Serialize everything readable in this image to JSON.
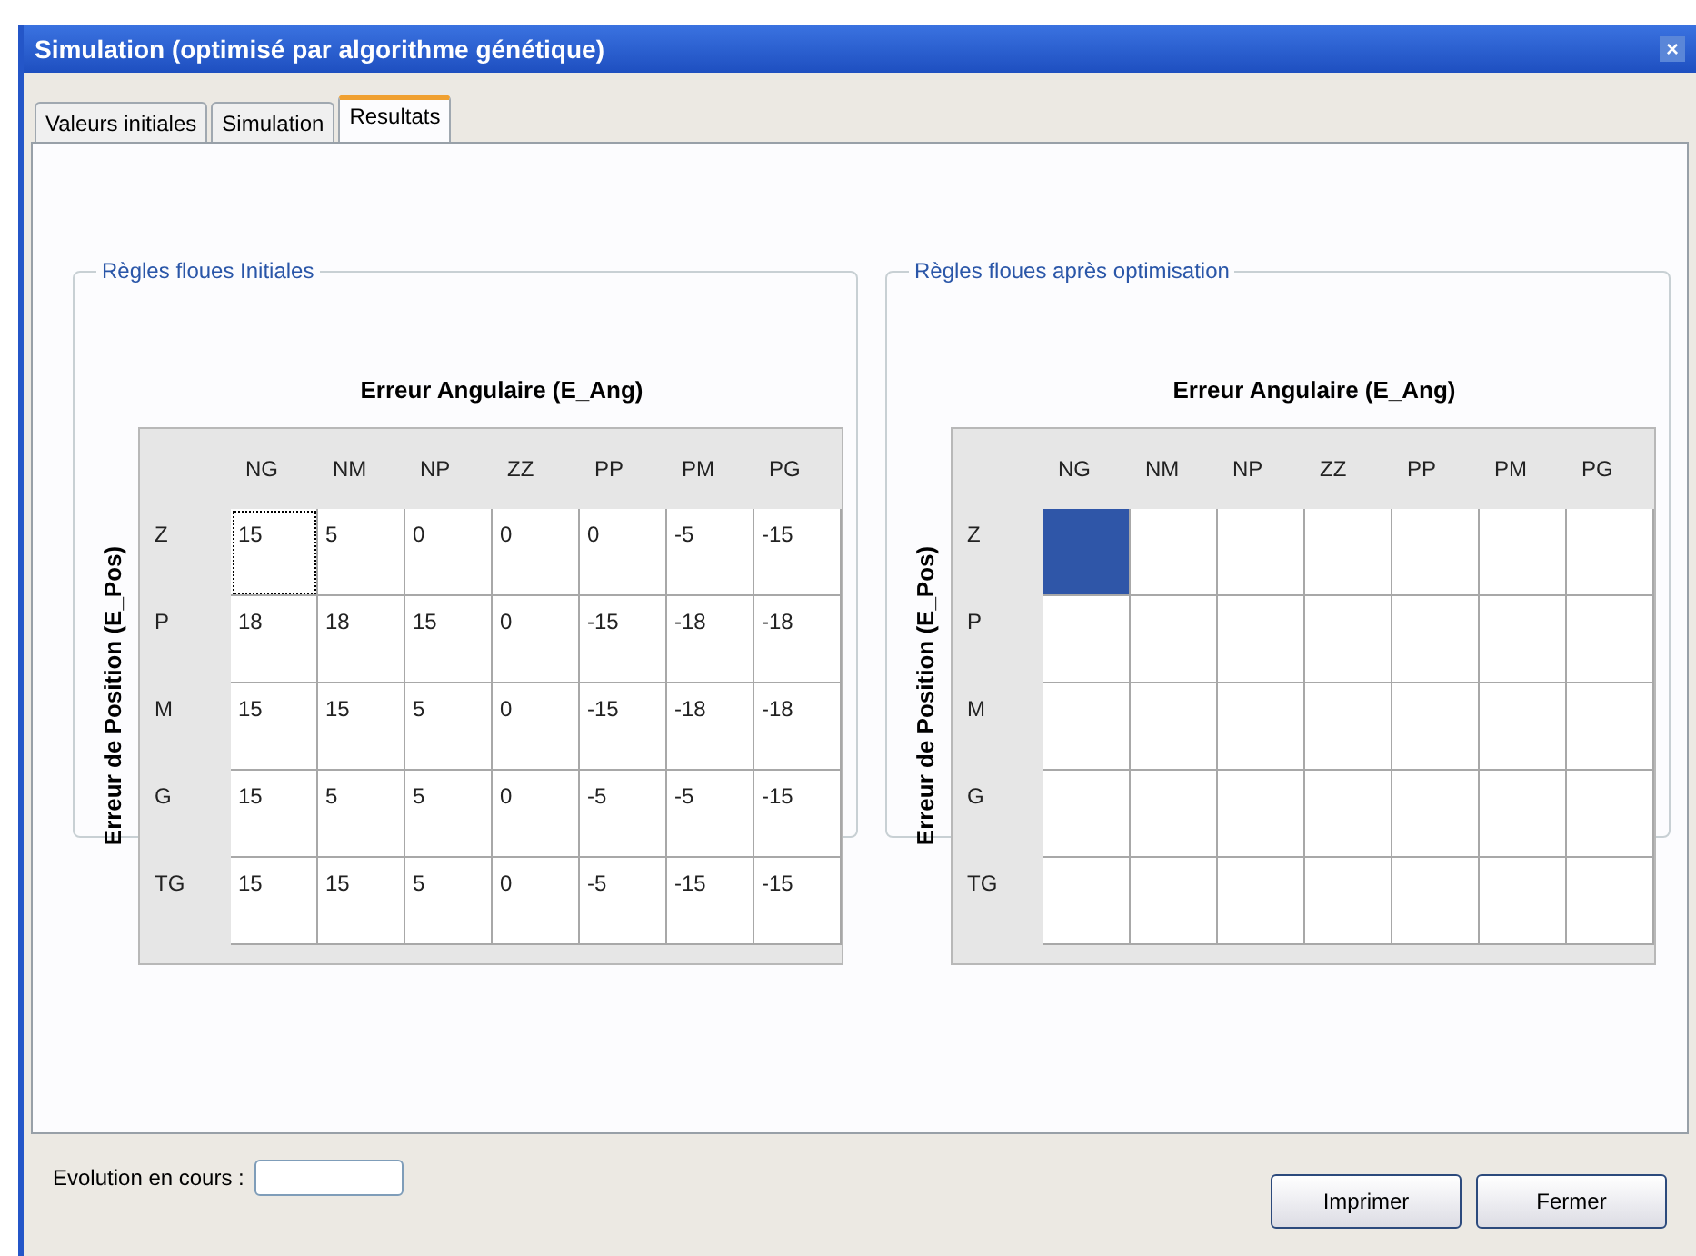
{
  "window": {
    "title": "Simulation (optimisé par algorithme génétique)",
    "close": "×"
  },
  "tabs": [
    {
      "label": "Valeurs initiales",
      "selected": false
    },
    {
      "label": "Simulation",
      "selected": false
    },
    {
      "label": "Resultats",
      "selected": true
    }
  ],
  "groups": [
    {
      "title": "Règles floues Initiales",
      "table_title": "Erreur Angulaire (E_Ang)",
      "row_axis": "Erreur de Position (E_Pos)",
      "columns": [
        "NG",
        "NM",
        "NP",
        "ZZ",
        "PP",
        "PM",
        "PG"
      ],
      "rows": [
        {
          "label": "Z",
          "cells": [
            {
              "value": "15",
              "selected": false,
              "focused": true
            },
            {
              "value": "5",
              "selected": false,
              "focused": false
            },
            {
              "value": "0",
              "selected": false,
              "focused": false
            },
            {
              "value": "0",
              "selected": false,
              "focused": false
            },
            {
              "value": "0",
              "selected": false,
              "focused": false
            },
            {
              "value": "-5",
              "selected": false,
              "focused": false
            },
            {
              "value": "-15",
              "selected": false,
              "focused": false
            }
          ]
        },
        {
          "label": "P",
          "cells": [
            {
              "value": "18",
              "selected": false,
              "focused": false
            },
            {
              "value": "18",
              "selected": false,
              "focused": false
            },
            {
              "value": "15",
              "selected": false,
              "focused": false
            },
            {
              "value": "0",
              "selected": false,
              "focused": false
            },
            {
              "value": "-15",
              "selected": false,
              "focused": false
            },
            {
              "value": "-18",
              "selected": false,
              "focused": false
            },
            {
              "value": "-18",
              "selected": false,
              "focused": false
            }
          ]
        },
        {
          "label": "M",
          "cells": [
            {
              "value": "15",
              "selected": false,
              "focused": false
            },
            {
              "value": "15",
              "selected": false,
              "focused": false
            },
            {
              "value": "5",
              "selected": false,
              "focused": false
            },
            {
              "value": "0",
              "selected": false,
              "focused": false
            },
            {
              "value": "-15",
              "selected": false,
              "focused": false
            },
            {
              "value": "-18",
              "selected": false,
              "focused": false
            },
            {
              "value": "-18",
              "selected": false,
              "focused": false
            }
          ]
        },
        {
          "label": "G",
          "cells": [
            {
              "value": "15",
              "selected": false,
              "focused": false
            },
            {
              "value": "5",
              "selected": false,
              "focused": false
            },
            {
              "value": "5",
              "selected": false,
              "focused": false
            },
            {
              "value": "0",
              "selected": false,
              "focused": false
            },
            {
              "value": "-5",
              "selected": false,
              "focused": false
            },
            {
              "value": "-5",
              "selected": false,
              "focused": false
            },
            {
              "value": "-15",
              "selected": false,
              "focused": false
            }
          ]
        },
        {
          "label": "TG",
          "cells": [
            {
              "value": "15",
              "selected": false,
              "focused": false
            },
            {
              "value": "15",
              "selected": false,
              "focused": false
            },
            {
              "value": "5",
              "selected": false,
              "focused": false
            },
            {
              "value": "0",
              "selected": false,
              "focused": false
            },
            {
              "value": "-5",
              "selected": false,
              "focused": false
            },
            {
              "value": "-15",
              "selected": false,
              "focused": false
            },
            {
              "value": "-15",
              "selected": false,
              "focused": false
            }
          ]
        }
      ]
    },
    {
      "title": "Règles floues après optimisation",
      "table_title": "Erreur Angulaire (E_Ang)",
      "row_axis": "Erreur de Position (E_Pos)",
      "columns": [
        "NG",
        "NM",
        "NP",
        "ZZ",
        "PP",
        "PM",
        "PG"
      ],
      "rows": [
        {
          "label": "Z",
          "cells": [
            {
              "selected": true,
              "focused": false
            },
            {
              "selected": false,
              "focused": false
            },
            {
              "selected": false,
              "focused": false
            },
            {
              "selected": false,
              "focused": false
            },
            {
              "selected": false,
              "focused": false
            },
            {
              "selected": false,
              "focused": false
            },
            {
              "selected": false,
              "focused": false
            }
          ]
        },
        {
          "label": "P",
          "cells": [
            {
              "selected": false,
              "focused": false
            },
            {
              "selected": false,
              "focused": false
            },
            {
              "selected": false,
              "focused": false
            },
            {
              "selected": false,
              "focused": false
            },
            {
              "selected": false,
              "focused": false
            },
            {
              "selected": false,
              "focused": false
            },
            {
              "selected": false,
              "focused": false
            }
          ]
        },
        {
          "label": "M",
          "cells": [
            {
              "selected": false,
              "focused": false
            },
            {
              "selected": false,
              "focused": false
            },
            {
              "selected": false,
              "focused": false
            },
            {
              "selected": false,
              "focused": false
            },
            {
              "selected": false,
              "focused": false
            },
            {
              "selected": false,
              "focused": false
            },
            {
              "selected": false,
              "focused": false
            }
          ]
        },
        {
          "label": "G",
          "cells": [
            {
              "selected": false,
              "focused": false
            },
            {
              "selected": false,
              "focused": false
            },
            {
              "selected": false,
              "focused": false
            },
            {
              "selected": false,
              "focused": false
            },
            {
              "selected": false,
              "focused": false
            },
            {
              "selected": false,
              "focused": false
            },
            {
              "selected": false,
              "focused": false
            }
          ]
        },
        {
          "label": "TG",
          "cells": [
            {
              "selected": false,
              "focused": false
            },
            {
              "selected": false,
              "focused": false
            },
            {
              "selected": false,
              "focused": false
            },
            {
              "selected": false,
              "focused": false
            },
            {
              "selected": false,
              "focused": false
            },
            {
              "selected": false,
              "focused": false
            },
            {
              "selected": false,
              "focused": false
            }
          ]
        }
      ]
    }
  ],
  "status": {
    "label": "Evolution en cours :"
  },
  "buttons": [
    "Imprimer",
    "Fermer"
  ]
}
